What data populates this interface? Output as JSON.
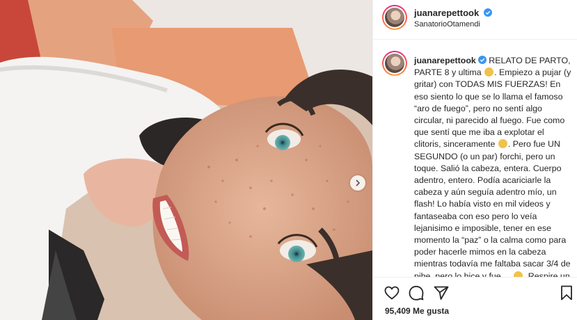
{
  "post": {
    "username": "juanarepettook",
    "location": "SanatorioOtamendi",
    "caption_title": "RELATO DE PARTO, PARTE 8 y ultima",
    "caption_body_1": "Empiezo a pujar (y gritar) con TODAS MIS FUERZAS! En eso siento lo que se lo llama el famoso “aro de fuego”, pero no sentí algo circular, ni parecido al fuego. Fue como que sentí que me iba a explotar el clitoris, sinceramente",
    "caption_body_2": ". Pero fue UN SEGUNDO (o un par) forchi, pero un toque. Salió la cabeza, entera. Cuerpo adentro, entero. Podía acariciarle la cabeza y aún seguía adentro mío, un flash! Lo había visto en mil videos y fantaseaba con eso pero lo veía lejanisimo e imposible, tener en ese momento la “paz” o la calma como para poder hacerle mimos en la cabeza mientras todavía me faltaba sacar 3/4 de pibe, pero lo hice y fue ...",
    "caption_body_3": ". Respire un par de",
    "likes": "95,409 Me gusta"
  },
  "icons": {
    "verified": "verified-badge-icon",
    "like": "heart-icon",
    "comment": "comment-icon",
    "share": "paper-plane-icon",
    "save": "bookmark-icon",
    "next": "chevron-right-icon"
  },
  "colors": {
    "verified": "#3897f0",
    "text": "#262626",
    "divider": "#efefef"
  }
}
